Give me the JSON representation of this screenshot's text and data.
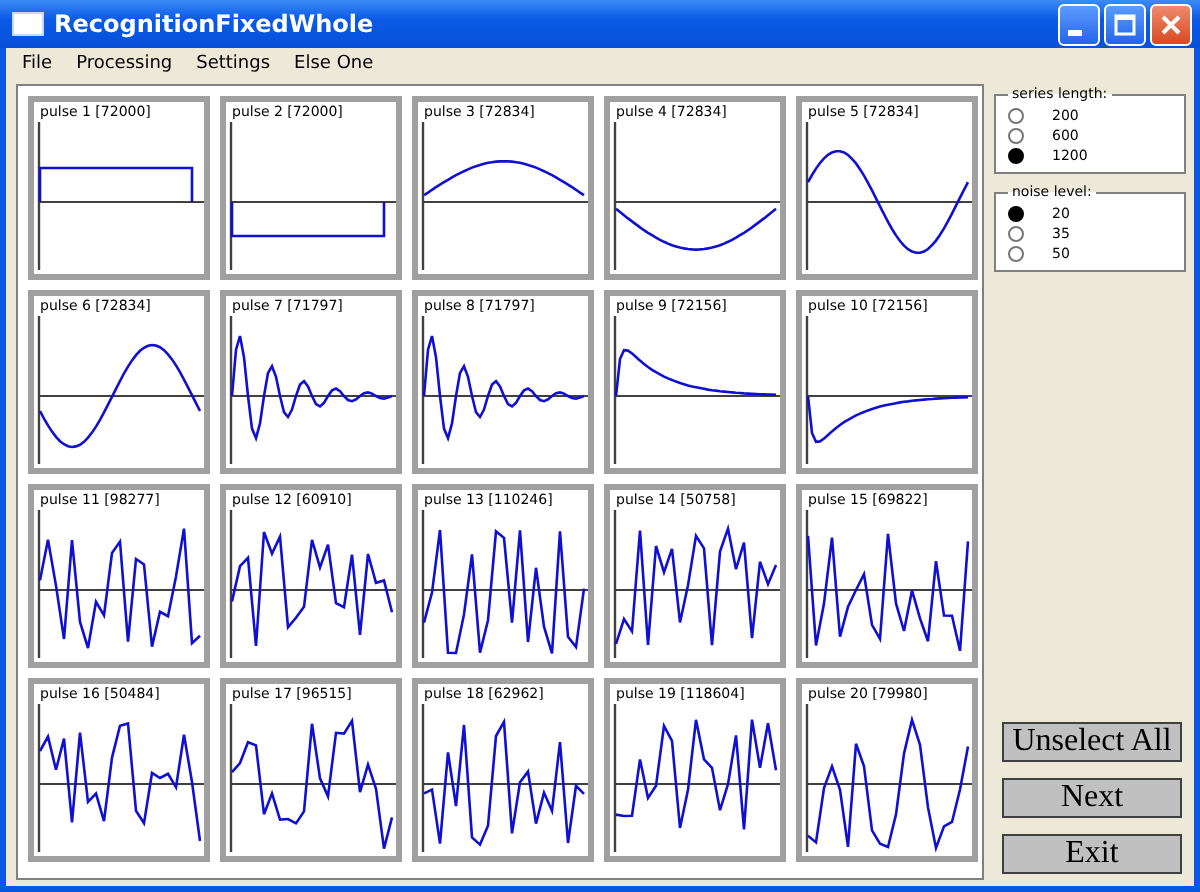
{
  "window": {
    "title": "RecognitionFixedWhole"
  },
  "menu": [
    "File",
    "Processing",
    "Settings",
    "Else One"
  ],
  "pulses": [
    {
      "label": "pulse 1 [72000]",
      "kind": "rect_pos"
    },
    {
      "label": "pulse 2 [72000]",
      "kind": "rect_neg"
    },
    {
      "label": "pulse 3 [72834]",
      "kind": "half_sine_pos"
    },
    {
      "label": "pulse 4 [72834]",
      "kind": "half_sine_neg"
    },
    {
      "label": "pulse 5 [72834]",
      "kind": "sine"
    },
    {
      "label": "pulse 6 [72834]",
      "kind": "sine_neg"
    },
    {
      "label": "pulse 7 [71797]",
      "kind": "damped"
    },
    {
      "label": "pulse 8 [71797]",
      "kind": "damped"
    },
    {
      "label": "pulse 9 [72156]",
      "kind": "decay_pos"
    },
    {
      "label": "pulse 10 [72156]",
      "kind": "decay_neg"
    },
    {
      "label": "pulse 11 [98277]",
      "kind": "noise"
    },
    {
      "label": "pulse 12 [60910]",
      "kind": "noise"
    },
    {
      "label": "pulse 13 [110246]",
      "kind": "noise"
    },
    {
      "label": "pulse 14 [50758]",
      "kind": "noise"
    },
    {
      "label": "pulse 15 [69822]",
      "kind": "noise"
    },
    {
      "label": "pulse 16 [50484]",
      "kind": "noise"
    },
    {
      "label": "pulse 17 [96515]",
      "kind": "noise"
    },
    {
      "label": "pulse 18 [62962]",
      "kind": "noise"
    },
    {
      "label": "pulse 19 [118604]",
      "kind": "noise"
    },
    {
      "label": "pulse 20 [79980]",
      "kind": "noise"
    }
  ],
  "series_length": {
    "legend": "series length:",
    "options": [
      {
        "label": "200",
        "selected": false
      },
      {
        "label": "600",
        "selected": false
      },
      {
        "label": "1200",
        "selected": true
      }
    ]
  },
  "noise_level": {
    "legend": "noise level:",
    "options": [
      {
        "label": "20",
        "selected": true
      },
      {
        "label": "35",
        "selected": false
      },
      {
        "label": "50",
        "selected": false
      }
    ]
  },
  "buttons": [
    "Unselect All",
    "Next",
    "Exit"
  ]
}
